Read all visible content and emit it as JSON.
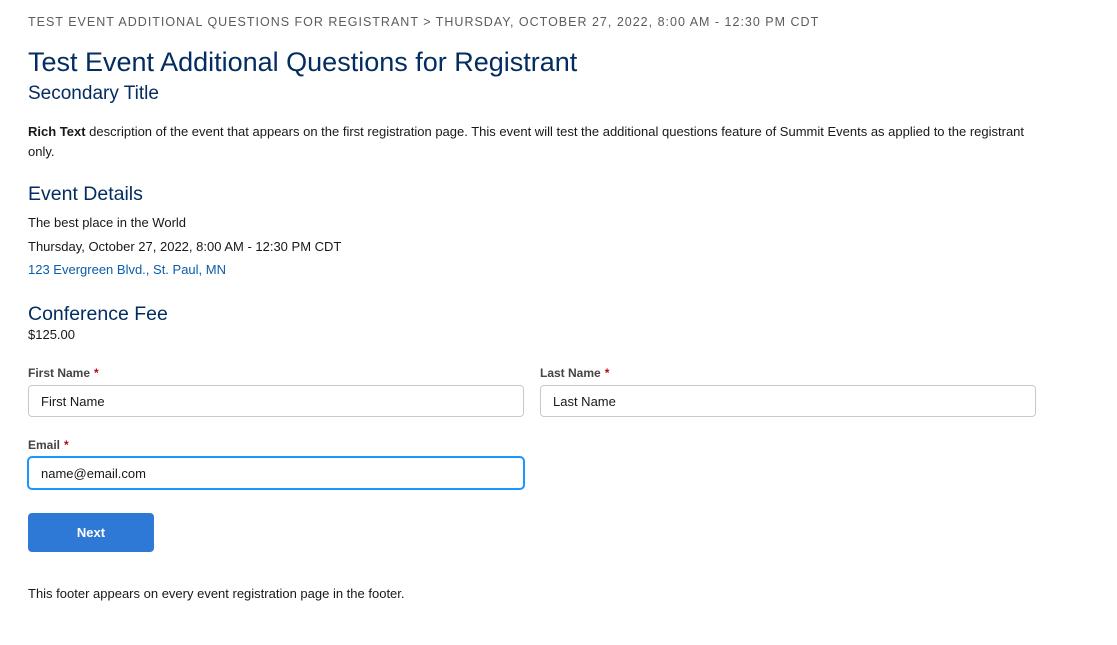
{
  "breadcrumb": {
    "text": "TEST EVENT ADDITIONAL QUESTIONS FOR REGISTRANT > THURSDAY, OCTOBER 27, 2022, 8:00 AM - 12:30 PM CDT"
  },
  "event": {
    "title": "Test Event Additional Questions for Registrant",
    "subtitle": "Secondary Title",
    "description_bold": "Rich Text",
    "description_rest": " description of the event that appears on the first registration page. This event will test the additional questions feature of Summit Events as applied to the registrant only."
  },
  "details": {
    "heading": "Event Details",
    "location": "The best place in the World",
    "date": "Thursday, October 27, 2022, 8:00 AM - 12:30 PM CDT",
    "address": "123 Evergreen Blvd., St. Paul, MN"
  },
  "fee": {
    "heading": "Conference Fee",
    "amount": "$125.00"
  },
  "form": {
    "required_marker": "*",
    "first_name": {
      "label": "First Name",
      "placeholder": "First Name",
      "value": ""
    },
    "last_name": {
      "label": "Last Name",
      "placeholder": "Last Name",
      "value": ""
    },
    "email": {
      "label": "Email",
      "placeholder": "",
      "value": "name@email.com"
    },
    "next_label": "Next"
  },
  "footer": {
    "text": "This footer appears on every event registration page in the footer."
  },
  "colors": {
    "heading": "#032d60",
    "link": "#0b5cab",
    "button": "#2e79d6",
    "required": "#ba0517",
    "focus": "#1b96ff"
  },
  "icons": []
}
